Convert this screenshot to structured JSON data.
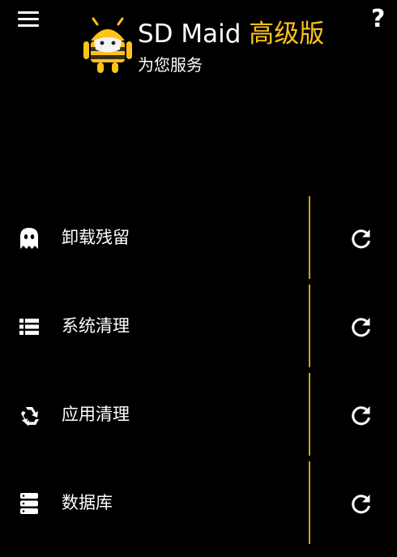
{
  "header": {
    "app_name": "SD Maid",
    "edition": "高级版",
    "subtitle": "为您服务",
    "help_label": "?",
    "accent_color": "#ffc21a"
  },
  "tools": [
    {
      "label": "卸载残留",
      "icon": "ghost-icon",
      "action_icon": "refresh-icon"
    },
    {
      "label": "系统清理",
      "icon": "list-icon",
      "action_icon": "refresh-icon"
    },
    {
      "label": "应用清理",
      "icon": "recycle-icon",
      "action_icon": "refresh-icon"
    },
    {
      "label": "数据库",
      "icon": "database-icon",
      "action_icon": "refresh-icon"
    }
  ],
  "divider_color": "#d2a21e"
}
